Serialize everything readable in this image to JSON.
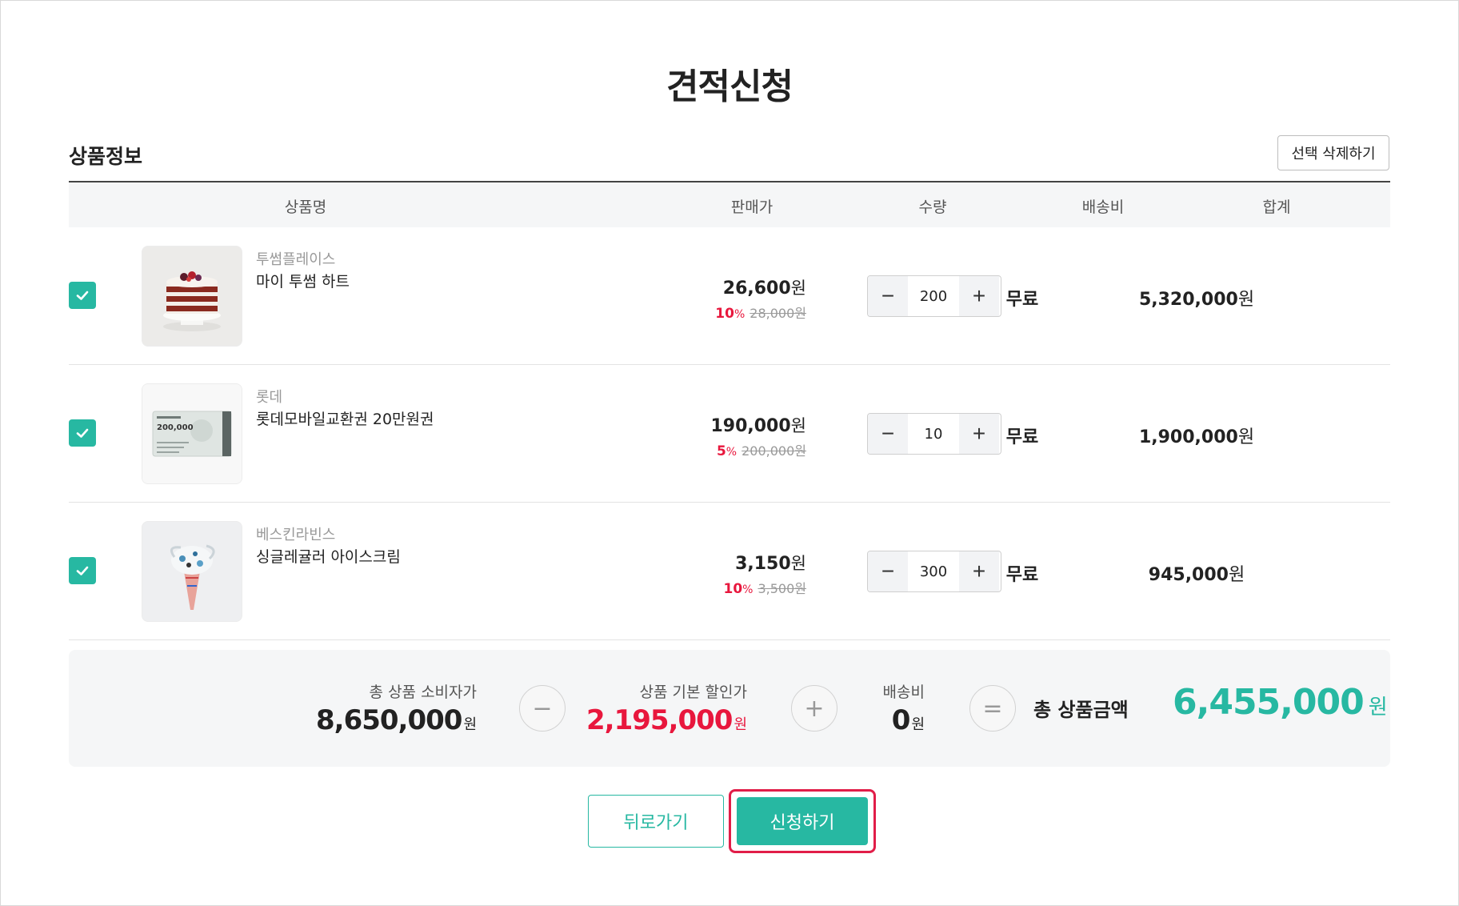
{
  "page": {
    "title": "견적신청"
  },
  "section": {
    "title": "상품정보",
    "delete_label": "선택 삭제하기"
  },
  "table": {
    "headers": {
      "name": "상품명",
      "price": "판매가",
      "qty": "수량",
      "shipping": "배송비",
      "total": "합계"
    }
  },
  "items": [
    {
      "checked": true,
      "brand": "투썸플레이스",
      "name": "마이 투썸 하트",
      "price": "26,600",
      "price_unit": "원",
      "discount_rate": "10",
      "discount_unit": "%",
      "original": "28,000원",
      "qty": "200",
      "shipping": "무료",
      "total": "5,320,000",
      "total_unit": "원",
      "image": "cake"
    },
    {
      "checked": true,
      "brand": "롯데",
      "name": "롯데모바일교환권 20만원권",
      "price": "190,000",
      "price_unit": "원",
      "discount_rate": "5",
      "discount_unit": "%",
      "original": "200,000원",
      "qty": "10",
      "shipping": "무료",
      "total": "1,900,000",
      "total_unit": "원",
      "image": "gift-card",
      "image_text": "200,000"
    },
    {
      "checked": true,
      "brand": "베스킨라빈스",
      "name": "싱글레귤러 아이스크림",
      "price": "3,150",
      "price_unit": "원",
      "discount_rate": "10",
      "discount_unit": "%",
      "original": "3,500원",
      "qty": "300",
      "shipping": "무료",
      "total": "945,000",
      "total_unit": "원",
      "image": "ice-cream"
    }
  ],
  "summary": {
    "consumer_label": "총 상품 소비자가",
    "consumer_value": "8,650,000",
    "discount_label": "상품 기본 할인가",
    "discount_value": "2,195,000",
    "shipping_label": "배송비",
    "shipping_value": "0",
    "unit": "원",
    "op_minus": "−",
    "op_plus": "+",
    "op_equals": "=",
    "total_label": "총 상품금액",
    "total_value": "6,455,000",
    "total_unit": "원"
  },
  "actions": {
    "back_label": "뒤로가기",
    "apply_label": "신청하기"
  },
  "colors": {
    "accent": "#27b8a2",
    "discount": "#e8173d",
    "highlight": "#e11d48"
  }
}
